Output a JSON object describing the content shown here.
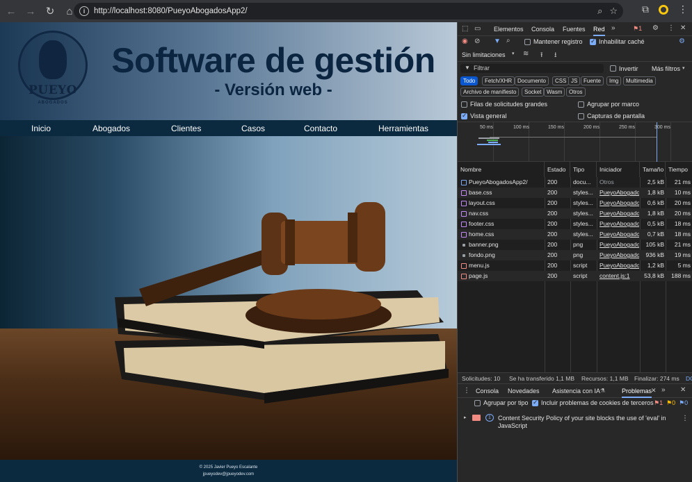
{
  "browser": {
    "url": "http://localhost:8080/PueyoAbogadosApp2/"
  },
  "page": {
    "logo_name": "PUEYO",
    "logo_sub": "ABOGADOS",
    "title": "Software de gestión",
    "subtitle": "- Versión web -",
    "nav": [
      "Inicio",
      "Abogados",
      "Clientes",
      "Casos",
      "Contacto",
      "Herramientas"
    ],
    "footer_line1": "© 2025 Javier Pueyo Escalante",
    "footer_line2": "jpueyodev@jpueyodev.com"
  },
  "devtools": {
    "tabs": [
      "Elementos",
      "Consola",
      "Fuentes",
      "Red"
    ],
    "active_tab": "Red",
    "error_badge": "1",
    "keep_log": "Mantener registro",
    "disable_cache": "Inhabilitar caché",
    "throttling": "Sin limitaciones",
    "filter_placeholder": "Filtrar",
    "invert": "Invertir",
    "more_filters": "Más filtros",
    "chips": [
      "Todo",
      "Fetch/XHR",
      "Documento",
      "CSS",
      "JS",
      "Fuente",
      "Img",
      "Multimedia",
      "Archivo de manifiesto",
      "Socket",
      "Wasm",
      "Otros"
    ],
    "opt_big_rows": "Filas de solicitudes grandes",
    "opt_group_frame": "Agrupar por marco",
    "opt_overview": "Vista general",
    "opt_screenshots": "Capturas de pantalla",
    "timeline_ticks": [
      "50 ms",
      "100 ms",
      "150 ms",
      "200 ms",
      "250 ms",
      "300 ms"
    ],
    "columns": [
      "Nombre",
      "Estado",
      "Tipo",
      "Iniciador",
      "Tamaño",
      "Tiempo"
    ],
    "rows": [
      {
        "name": "PueyoAbogadosApp2/",
        "status": "200",
        "type": "docu...",
        "initiator": "Otros",
        "size": "2,5 kB",
        "time": "21 ms",
        "kind": "doc"
      },
      {
        "name": "base.css",
        "status": "200",
        "type": "styles...",
        "initiator": "PueyoAbogados",
        "size": "1,8 kB",
        "time": "10 ms",
        "kind": "css"
      },
      {
        "name": "layout.css",
        "status": "200",
        "type": "styles...",
        "initiator": "PueyoAbogados",
        "size": "0,6 kB",
        "time": "20 ms",
        "kind": "css"
      },
      {
        "name": "nav.css",
        "status": "200",
        "type": "styles...",
        "initiator": "PueyoAbogados",
        "size": "1,8 kB",
        "time": "20 ms",
        "kind": "css"
      },
      {
        "name": "footer.css",
        "status": "200",
        "type": "styles...",
        "initiator": "PueyoAbogados",
        "size": "0,5 kB",
        "time": "18 ms",
        "kind": "css"
      },
      {
        "name": "home.css",
        "status": "200",
        "type": "styles...",
        "initiator": "PueyoAbogados",
        "size": "0,7 kB",
        "time": "18 ms",
        "kind": "css"
      },
      {
        "name": "banner.png",
        "status": "200",
        "type": "png",
        "initiator": "PueyoAbogados",
        "size": "105 kB",
        "time": "21 ms",
        "kind": "img"
      },
      {
        "name": "fondo.png",
        "status": "200",
        "type": "png",
        "initiator": "PueyoAbogados",
        "size": "936 kB",
        "time": "19 ms",
        "kind": "img"
      },
      {
        "name": "menu.js",
        "status": "200",
        "type": "script",
        "initiator": "PueyoAbogados",
        "size": "1,2 kB",
        "time": "5 ms",
        "kind": "js"
      },
      {
        "name": "page.js",
        "status": "200",
        "type": "script",
        "initiator": "content.js:1",
        "size": "53,8 kB",
        "time": "188 ms",
        "kind": "js"
      }
    ],
    "summary": [
      "Solicitudes: 10",
      "Se ha transferido 1,1 MB",
      "Recursos: 1,1 MB",
      "Finalizar: 274 ms",
      "DC"
    ],
    "drawer_tabs": [
      "Consola",
      "Novedades",
      "Asistencia con IA",
      "Problemas"
    ],
    "drawer_active": "Problemas",
    "group_by_type": "Agrupar por tipo",
    "include_cookies": "Incluir problemas de cookies de terceros",
    "issue_counts": [
      "1",
      "0",
      "0"
    ],
    "issue_count_badge": "1",
    "issue_text_1": "Content Security Policy of your site blocks the use of 'eval' in",
    "issue_text_2": "JavaScript"
  }
}
